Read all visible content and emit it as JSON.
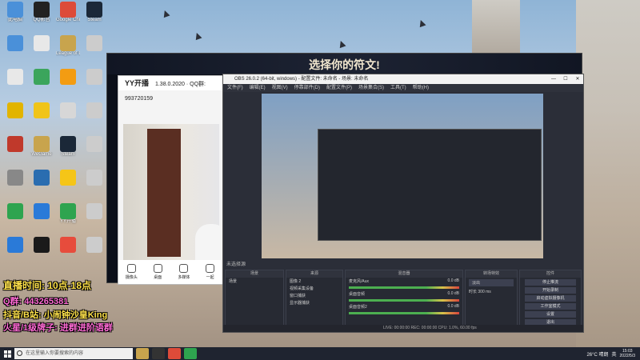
{
  "desktop": {
    "icons": [
      {
        "label": "此电脑",
        "color": "#4a90d9"
      },
      {
        "label": "QQ影音",
        "color": "#222"
      },
      {
        "label": "Google Chrome",
        "color": "#dd4b39"
      },
      {
        "label": "Steam",
        "color": "#1b2838"
      },
      {
        "label": "",
        "color": "#4a90d9"
      },
      {
        "label": "",
        "color": "#e8e8e8"
      },
      {
        "label": "League of Legends",
        "color": "#c8a44d"
      },
      {
        "label": "",
        "color": "#ccc"
      },
      {
        "label": "",
        "color": "#e8e8e8"
      },
      {
        "label": "",
        "color": "#3ba55c"
      },
      {
        "label": "",
        "color": "#f39c12"
      },
      {
        "label": "",
        "color": "#ccc"
      },
      {
        "label": "",
        "color": "#e2b400"
      },
      {
        "label": "",
        "color": "#f0c419"
      },
      {
        "label": "",
        "color": "#d7d7d7"
      },
      {
        "label": "",
        "color": "#ccc"
      },
      {
        "label": "",
        "color": "#c0392b"
      },
      {
        "label": "WeGame",
        "color": "#c8a44d"
      },
      {
        "label": "Steam",
        "color": "#1b2838"
      },
      {
        "label": "",
        "color": "#ccc"
      },
      {
        "label": "",
        "color": "#888"
      },
      {
        "label": "",
        "color": "#2a6db0"
      },
      {
        "label": "",
        "color": "#f5c518"
      },
      {
        "label": "",
        "color": "#ccc"
      },
      {
        "label": "",
        "color": "#2ea44f"
      },
      {
        "label": "",
        "color": "#2a7ad8"
      },
      {
        "label": "YY开播",
        "color": "#2ea44f"
      },
      {
        "label": "",
        "color": "#ccc"
      },
      {
        "label": "",
        "color": "#2a7ad8"
      },
      {
        "label": "",
        "color": "#1a1a1a"
      },
      {
        "label": "",
        "color": "#e74c3c"
      },
      {
        "label": "",
        "color": "#ccc"
      }
    ]
  },
  "game_window": {
    "title": "选择你的符文!"
  },
  "yy_window": {
    "title": "YY开播",
    "version": "1.38.0.2020 · QQ群: 993720159",
    "buttons": [
      "摄像头",
      "桌面",
      "多媒体",
      "一起"
    ]
  },
  "obs": {
    "title": "OBS 26.0.2 (64-bit, windows) - 配置文件: 未命名 - 场景: 未命名",
    "menu": [
      "文件(F)",
      "编辑(E)",
      "视图(V)",
      "停靠部件(D)",
      "配置文件(P)",
      "场景集合(S)",
      "工具(T)",
      "帮助(H)"
    ],
    "scene_label": "未选择源",
    "docks": {
      "scenes": {
        "title": "场景",
        "items": [
          "场景"
        ]
      },
      "sources": {
        "title": "来源",
        "items": [
          "图像 2",
          "视频采集设备",
          "窗口捕获",
          "显示器捕获"
        ]
      },
      "mixer": {
        "title": "混音器",
        "items": [
          "麦克风/Aux",
          "桌面音频",
          "桌面音频2"
        ],
        "db": [
          "0.0 dB",
          "0.0 dB",
          "0.0 dB"
        ]
      },
      "transitions": {
        "title": "转场特效",
        "mode": "淡出",
        "duration_label": "时长",
        "duration": "300 ms"
      },
      "controls": {
        "title": "控件",
        "buttons": [
          "停止推流",
          "开始录制",
          "启动虚拟摄像机",
          "工作室模式",
          "设置",
          "退出"
        ]
      }
    },
    "status": "LIVE: 00:00:00  REC: 00:00:00  CPU: 1.0%, 60.00 fps"
  },
  "overlay": {
    "live_time": "直播时间: 10点-18点",
    "qq": "Q群: 443265381",
    "douyin": "抖音/B站: 小闹钟沙皇King",
    "banner": "火星/1级牌子: 进群进阶语群"
  },
  "taskbar": {
    "search_placeholder": "在这里输入你要搜索的内容",
    "weather": "26°C 晴朗",
    "ime": "英",
    "time": "15:03",
    "date": "2022/5/3"
  },
  "colors": {
    "obs_bg": "#2b2e38",
    "accent": "#2ea44f"
  }
}
